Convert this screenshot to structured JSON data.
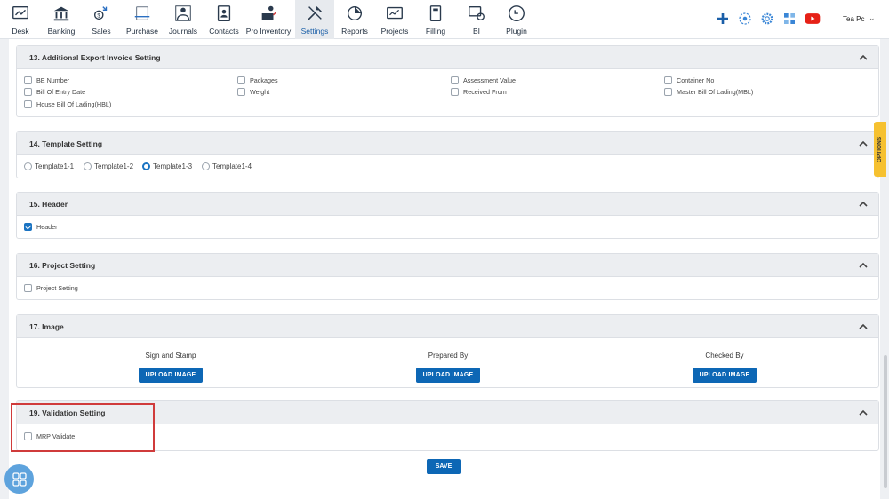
{
  "nav": {
    "items": [
      {
        "label": "Desk",
        "icon": "desk-icon"
      },
      {
        "label": "Banking",
        "icon": "bank-icon"
      },
      {
        "label": "Sales",
        "icon": "sales-icon"
      },
      {
        "label": "Purchase",
        "icon": "purchase-icon"
      },
      {
        "label": "Journals",
        "icon": "journals-icon"
      },
      {
        "label": "Contacts",
        "icon": "contacts-icon"
      },
      {
        "label": "Pro Inventory",
        "icon": "inventory-icon"
      },
      {
        "label": "Settings",
        "icon": "settings-icon"
      },
      {
        "label": "Reports",
        "icon": "reports-icon"
      },
      {
        "label": "Projects",
        "icon": "projects-icon"
      },
      {
        "label": "Filling",
        "icon": "filling-icon"
      },
      {
        "label": "BI",
        "icon": "bi-icon"
      },
      {
        "label": "Plugin",
        "icon": "plugin-icon"
      }
    ],
    "active": "Settings",
    "user_name": "Tea Pc"
  },
  "sections": {
    "export_invoice": {
      "title": "13. Additional Export Invoice Setting",
      "options": [
        {
          "label": "BE Number",
          "checked": false
        },
        {
          "label": "Packages",
          "checked": false
        },
        {
          "label": "Assessment Value",
          "checked": false
        },
        {
          "label": "Container No",
          "checked": false
        },
        {
          "label": "Bill Of Entry Date",
          "checked": false
        },
        {
          "label": "Weight",
          "checked": false
        },
        {
          "label": "Received From",
          "checked": false
        },
        {
          "label": "Master Bill Of Lading(MBL)",
          "checked": false
        },
        {
          "label": "House Bill Of Lading(HBL)",
          "checked": false
        }
      ]
    },
    "template": {
      "title": "14. Template Setting",
      "options": [
        "Template1-1",
        "Template1-2",
        "Template1-3",
        "Template1-4"
      ],
      "selected": "Template1-3"
    },
    "header": {
      "title": "15. Header",
      "option": {
        "label": "Header",
        "checked": true
      }
    },
    "project": {
      "title": "16. Project Setting",
      "option": {
        "label": "Project Setting",
        "checked": false
      }
    },
    "image": {
      "title": "17. Image",
      "columns": [
        {
          "label": "Sign and Stamp",
          "button": "UPLOAD IMAGE"
        },
        {
          "label": "Prepared By",
          "button": "UPLOAD IMAGE"
        },
        {
          "label": "Checked By",
          "button": "UPLOAD IMAGE"
        }
      ]
    },
    "validation": {
      "title": "19. Validation Setting",
      "option": {
        "label": "MRP Validate",
        "checked": false
      }
    }
  },
  "save_label": "SAVE",
  "options_tab_label": "OPTIONS",
  "colors": {
    "primary": "#0d67b5",
    "accent_tab": "#f6c130",
    "highlight": "#d03b3b",
    "youtube": "#e62117"
  }
}
